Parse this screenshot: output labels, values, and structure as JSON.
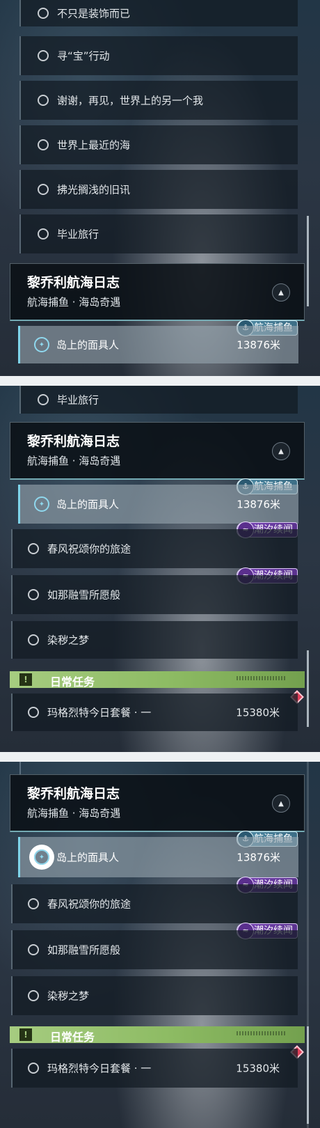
{
  "panel1": {
    "quests": [
      {
        "label": "不只是装饰而已"
      },
      {
        "label": "寻“宝”行动"
      },
      {
        "label": "谢谢，再见，世界上的另一个我"
      },
      {
        "label": "世界上最近的海"
      },
      {
        "label": "拂光搁浅的旧讯"
      },
      {
        "label": "毕业旅行"
      }
    ],
    "header": {
      "title": "黎乔利航海日志",
      "subtitle": "航海捕鱼 · 海岛奇遇"
    },
    "active": {
      "label": "岛上的面具人",
      "distance": "13876米",
      "tag": "航海捕鱼"
    }
  },
  "panel2": {
    "quest_top": {
      "label": "毕业旅行"
    },
    "header": {
      "title": "黎乔利航海日志",
      "subtitle": "航海捕鱼 · 海岛奇遇"
    },
    "active": {
      "label": "岛上的面具人",
      "distance": "13876米",
      "tag": "航海捕鱼"
    },
    "quests": [
      {
        "label": "春风祝颂你的旅途",
        "tag": "潮汐续闻"
      },
      {
        "label": "如那融雪所愿般",
        "tag": "潮汐续闻"
      },
      {
        "label": "染秽之梦"
      }
    ],
    "daily": {
      "label": "日常任务",
      "icon": "!"
    },
    "daily_quest": {
      "label": "玛格烈特今日套餐 · 一",
      "distance": "15380米"
    }
  },
  "panel3": {
    "header": {
      "title": "黎乔利航海日志",
      "subtitle": "航海捕鱼 · 海岛奇遇"
    },
    "active": {
      "label": "岛上的面具人",
      "distance": "13876米",
      "tag": "航海捕鱼"
    },
    "quests": [
      {
        "label": "春风祝颂你的旅途",
        "tag": "潮汐续闻"
      },
      {
        "label": "如那融雪所愿般",
        "tag": "潮汐续闻"
      },
      {
        "label": "染秽之梦"
      }
    ],
    "daily": {
      "label": "日常任务",
      "icon": "!"
    },
    "daily_quest": {
      "label": "玛格烈特今日套餐 · 一",
      "distance": "15380米"
    }
  },
  "icons": {
    "target": "navigation-target-icon",
    "collapse": "chevron-up-icon",
    "fishing": "fishing-hook-icon",
    "tide": "tide-wave-icon",
    "daily": "exclamation-icon",
    "priority": "diamond-icon"
  },
  "colors": {
    "accent_cyan": "#7fd4ea",
    "daily_green": "#a6cc80",
    "tide_purple": "#7b48b8",
    "fishing_blue": "#4f8ea8",
    "priority_red": "#e0405a"
  }
}
